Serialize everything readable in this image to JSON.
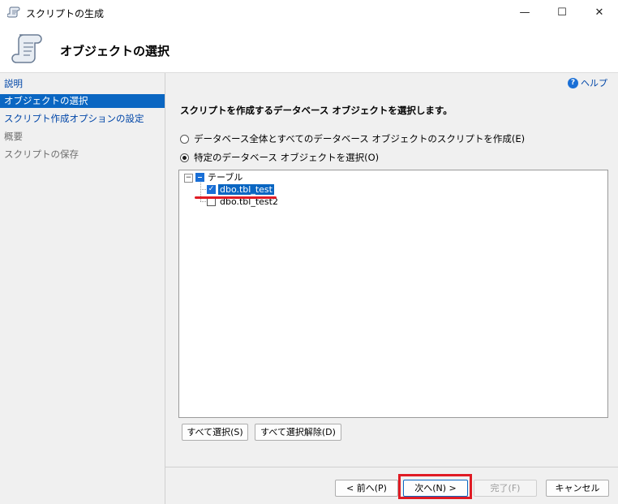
{
  "window": {
    "title": "スクリプトの生成",
    "minimize_glyph": "—",
    "maximize_glyph": "☐",
    "close_glyph": "✕"
  },
  "header": {
    "page_title": "オブジェクトの選択"
  },
  "sidebar": {
    "items": [
      {
        "label": "説明",
        "state": "link"
      },
      {
        "label": "オブジェクトの選択",
        "state": "selected"
      },
      {
        "label": "スクリプト作成オプションの設定",
        "state": "link"
      },
      {
        "label": "概要",
        "state": "disabled"
      },
      {
        "label": "スクリプトの保存",
        "state": "disabled"
      }
    ]
  },
  "main": {
    "help_label": "ヘルプ",
    "help_icon_glyph": "?",
    "instruction": "スクリプトを作成するデータベース オブジェクトを選択します。",
    "radio_all": "データベース全体とすべてのデータベース オブジェクトのスクリプトを作成(E)",
    "radio_specific": "特定のデータベース オブジェクトを選択(O)",
    "tree": {
      "expander_glyph": "−",
      "root_label": "テーブル",
      "items": [
        {
          "label": "dbo.tbl_test",
          "checked": true
        },
        {
          "label": "dbo.tbl_test2",
          "checked": false
        }
      ],
      "check_glyph": "✓"
    },
    "select_all_button": "すべて選択(S)",
    "deselect_all_button": "すべて選択解除(D)"
  },
  "footer": {
    "prev_button": "< 前へ(P)",
    "next_button": "次へ(N) >",
    "finish_button": "完了(F)",
    "cancel_button": "キャンセル"
  },
  "colors": {
    "selection": "#0a66c2",
    "link": "#0046a8",
    "annotation_red": "#e01b24"
  }
}
